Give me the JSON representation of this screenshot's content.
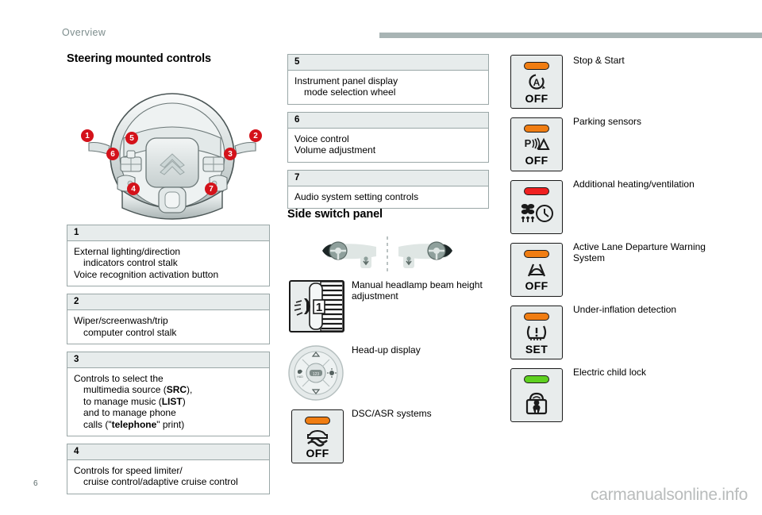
{
  "header": {
    "section_label": "Overview",
    "rule_color": "#a8b4b4"
  },
  "left_column": {
    "title": "Steering mounted controls",
    "wheel_callouts": [
      "1",
      "2",
      "3",
      "4",
      "5",
      "6",
      "7"
    ],
    "tables": [
      {
        "number": "1",
        "lines": [
          {
            "text": "External lighting/direction",
            "indent": false
          },
          {
            "text": "indicators control stalk",
            "indent": true
          },
          {
            "text": "Voice recognition activation button",
            "indent": false
          }
        ]
      },
      {
        "number": "2",
        "lines": [
          {
            "text": "Wiper/screenwash/trip",
            "indent": false
          },
          {
            "text": "computer control stalk",
            "indent": true
          }
        ]
      },
      {
        "number": "3",
        "lines": [
          {
            "text": "Controls to select the",
            "indent": false
          },
          {
            "text": "multimedia source (SRC),",
            "indent": true
          },
          {
            "text": "to manage music (LIST)",
            "indent": true
          },
          {
            "text": "and to manage phone",
            "indent": true
          },
          {
            "text": "calls (\"telephone\" print)",
            "indent": true
          }
        ]
      },
      {
        "number": "4",
        "lines": [
          {
            "text": "Controls for speed limiter/",
            "indent": false
          },
          {
            "text": "cruise control/adaptive cruise control",
            "indent": true
          }
        ]
      }
    ]
  },
  "mid_column": {
    "tables": [
      {
        "number": "5",
        "lines": [
          {
            "text": "Instrument panel display",
            "indent": false
          },
          {
            "text": "mode selection wheel",
            "indent": true
          }
        ]
      },
      {
        "number": "6",
        "lines": [
          {
            "text": "Voice control",
            "indent": false
          },
          {
            "text": "Volume adjustment",
            "indent": false
          }
        ]
      },
      {
        "number": "7",
        "lines": [
          {
            "text": "Audio system setting controls",
            "indent": false
          }
        ]
      }
    ],
    "title": "Side switch panel",
    "items": [
      {
        "icon": "headlamp-beam-height-adjuster-icon",
        "label_line1": "Manual headlamp beam height",
        "label_line2": "adjustment",
        "wheel_number": "1"
      },
      {
        "icon": "head-up-display-pad-icon",
        "label_line1": "Head-up display",
        "label_line2": ""
      },
      {
        "icon": "dsc-asr-off-button-icon",
        "label_line1": "DSC/ASR systems",
        "label_line2": "",
        "led_color": "#f07d12",
        "button_text": "OFF"
      }
    ]
  },
  "right_column": {
    "items": [
      {
        "icon": "stop-start-off-button-icon",
        "label_line1": "Stop & Start",
        "label_line2": "",
        "led_color": "#f07d12",
        "button_text": "OFF"
      },
      {
        "icon": "parking-sensors-off-button-icon",
        "label_line1": "Parking sensors",
        "label_line2": "",
        "led_color": "#f07d12",
        "button_text": "OFF"
      },
      {
        "icon": "additional-heating-ventilation-button-icon",
        "label_line1": "Additional heating/ventilation",
        "label_line2": "",
        "led_color": "#ef2020",
        "button_text": ""
      },
      {
        "icon": "lane-departure-warning-off-button-icon",
        "label_line1": "Active Lane Departure Warning",
        "label_line2": "System",
        "led_color": "#f07d12",
        "button_text": "OFF"
      },
      {
        "icon": "under-inflation-detection-set-button-icon",
        "label_line1": "Under-inflation detection",
        "label_line2": "",
        "led_color": "#f07d12",
        "button_text": "SET"
      },
      {
        "icon": "electric-child-lock-button-icon",
        "label_line1": "Electric child lock",
        "label_line2": "",
        "led_color": "#5ed020",
        "button_text": ""
      }
    ]
  },
  "footer": {
    "page_number": "6",
    "watermark": "carmanualsonline.info"
  }
}
